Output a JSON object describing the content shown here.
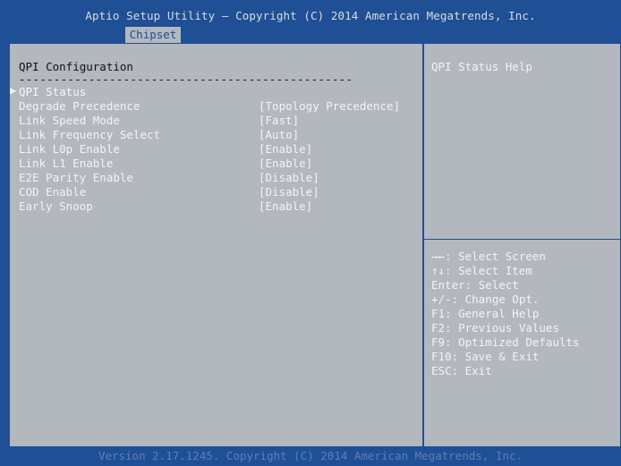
{
  "header": {
    "title": "Aptio Setup Utility – Copyright (C) 2014 American Megatrends, Inc.",
    "tab": "Chipset"
  },
  "main": {
    "section_title": "QPI Configuration",
    "separator": "------------------------------------------------",
    "items": [
      {
        "label": "QPI Status",
        "value": ""
      },
      {
        "label": "Degrade Precedence",
        "value": "[Topology Precedence]"
      },
      {
        "label": "Link Speed Mode",
        "value": "[Fast]"
      },
      {
        "label": "Link Frequency Select",
        "value": "[Auto]"
      },
      {
        "label": "Link L0p Enable",
        "value": "[Enable]"
      },
      {
        "label": "Link L1 Enable",
        "value": "[Enable]"
      },
      {
        "label": "E2E Parity Enable",
        "value": "[Disable]"
      },
      {
        "label": "COD Enable",
        "value": "[Disable]"
      },
      {
        "label": "Early Snoop",
        "value": "[Enable]"
      }
    ]
  },
  "help": {
    "title": "QPI Status Help",
    "keys": [
      "→←: Select Screen",
      "↑↓: Select Item",
      "Enter: Select",
      "+/-: Change Opt.",
      "F1: General Help",
      "F2: Previous Values",
      "F9: Optimized Defaults",
      "F10: Save & Exit",
      "ESC: Exit"
    ]
  },
  "footer": {
    "version": "Version 2.17.1245. Copyright (C) 2014 American Megatrends, Inc."
  },
  "colors": {
    "frame_blue": "#1f4f95",
    "panel_gray": "#b3b7be",
    "text_white": "#f2f4f7",
    "text_dark": "#101214"
  }
}
